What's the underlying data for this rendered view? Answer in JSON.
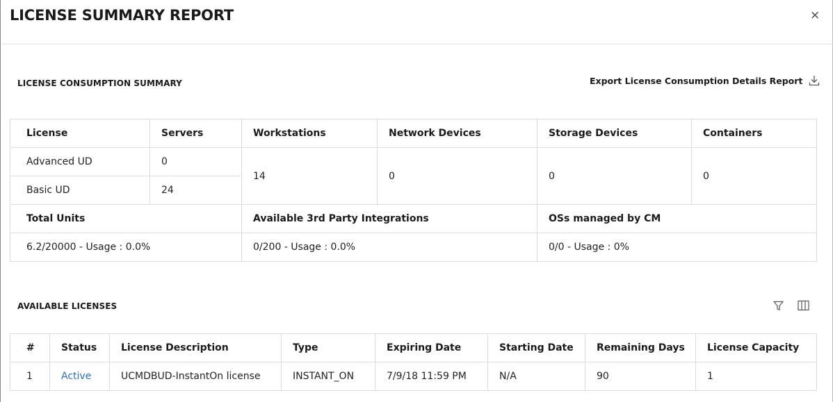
{
  "header": {
    "title": "LICENSE SUMMARY REPORT",
    "close_glyph": "×"
  },
  "consumption": {
    "section_title": "LICENSE CONSUMPTION SUMMARY",
    "export_label": "Export License Consumption Details Report",
    "columns": [
      "License",
      "Servers",
      "Workstations",
      "Network Devices",
      "Storage Devices",
      "Containers"
    ],
    "rows": [
      {
        "license": "Advanced UD",
        "servers": "0"
      },
      {
        "license": "Basic UD",
        "servers": "24"
      }
    ],
    "workstations": "14",
    "network_devices": "0",
    "storage_devices": "0",
    "containers": "0",
    "totals_labels": [
      "Total Units",
      "Available 3rd Party Integrations",
      "OSs managed by CM"
    ],
    "totals_values": [
      "6.2/20000 - Usage : 0.0%",
      "0/200 - Usage : 0.0%",
      "0/0 - Usage : 0%"
    ]
  },
  "available": {
    "section_title": "AVAILABLE LICENSES",
    "columns": [
      "#",
      "Status",
      "License Description",
      "Type",
      "Expiring Date",
      "Starting Date",
      "Remaining Days",
      "License Capacity"
    ],
    "rows": [
      {
        "num": "1",
        "status": "Active",
        "description": "UCMDBUD-InstantOn license",
        "type": "INSTANT_ON",
        "expiring": "7/9/18 11:59 PM",
        "starting": "N/A",
        "remaining": "90",
        "capacity": "1"
      }
    ]
  },
  "icons": {
    "close": "close-icon",
    "export": "download-icon",
    "filter": "filter-icon",
    "columns": "columns-icon"
  },
  "colors": {
    "link": "#2f6fb8",
    "border": "#dcdcdc",
    "text": "#222222"
  }
}
